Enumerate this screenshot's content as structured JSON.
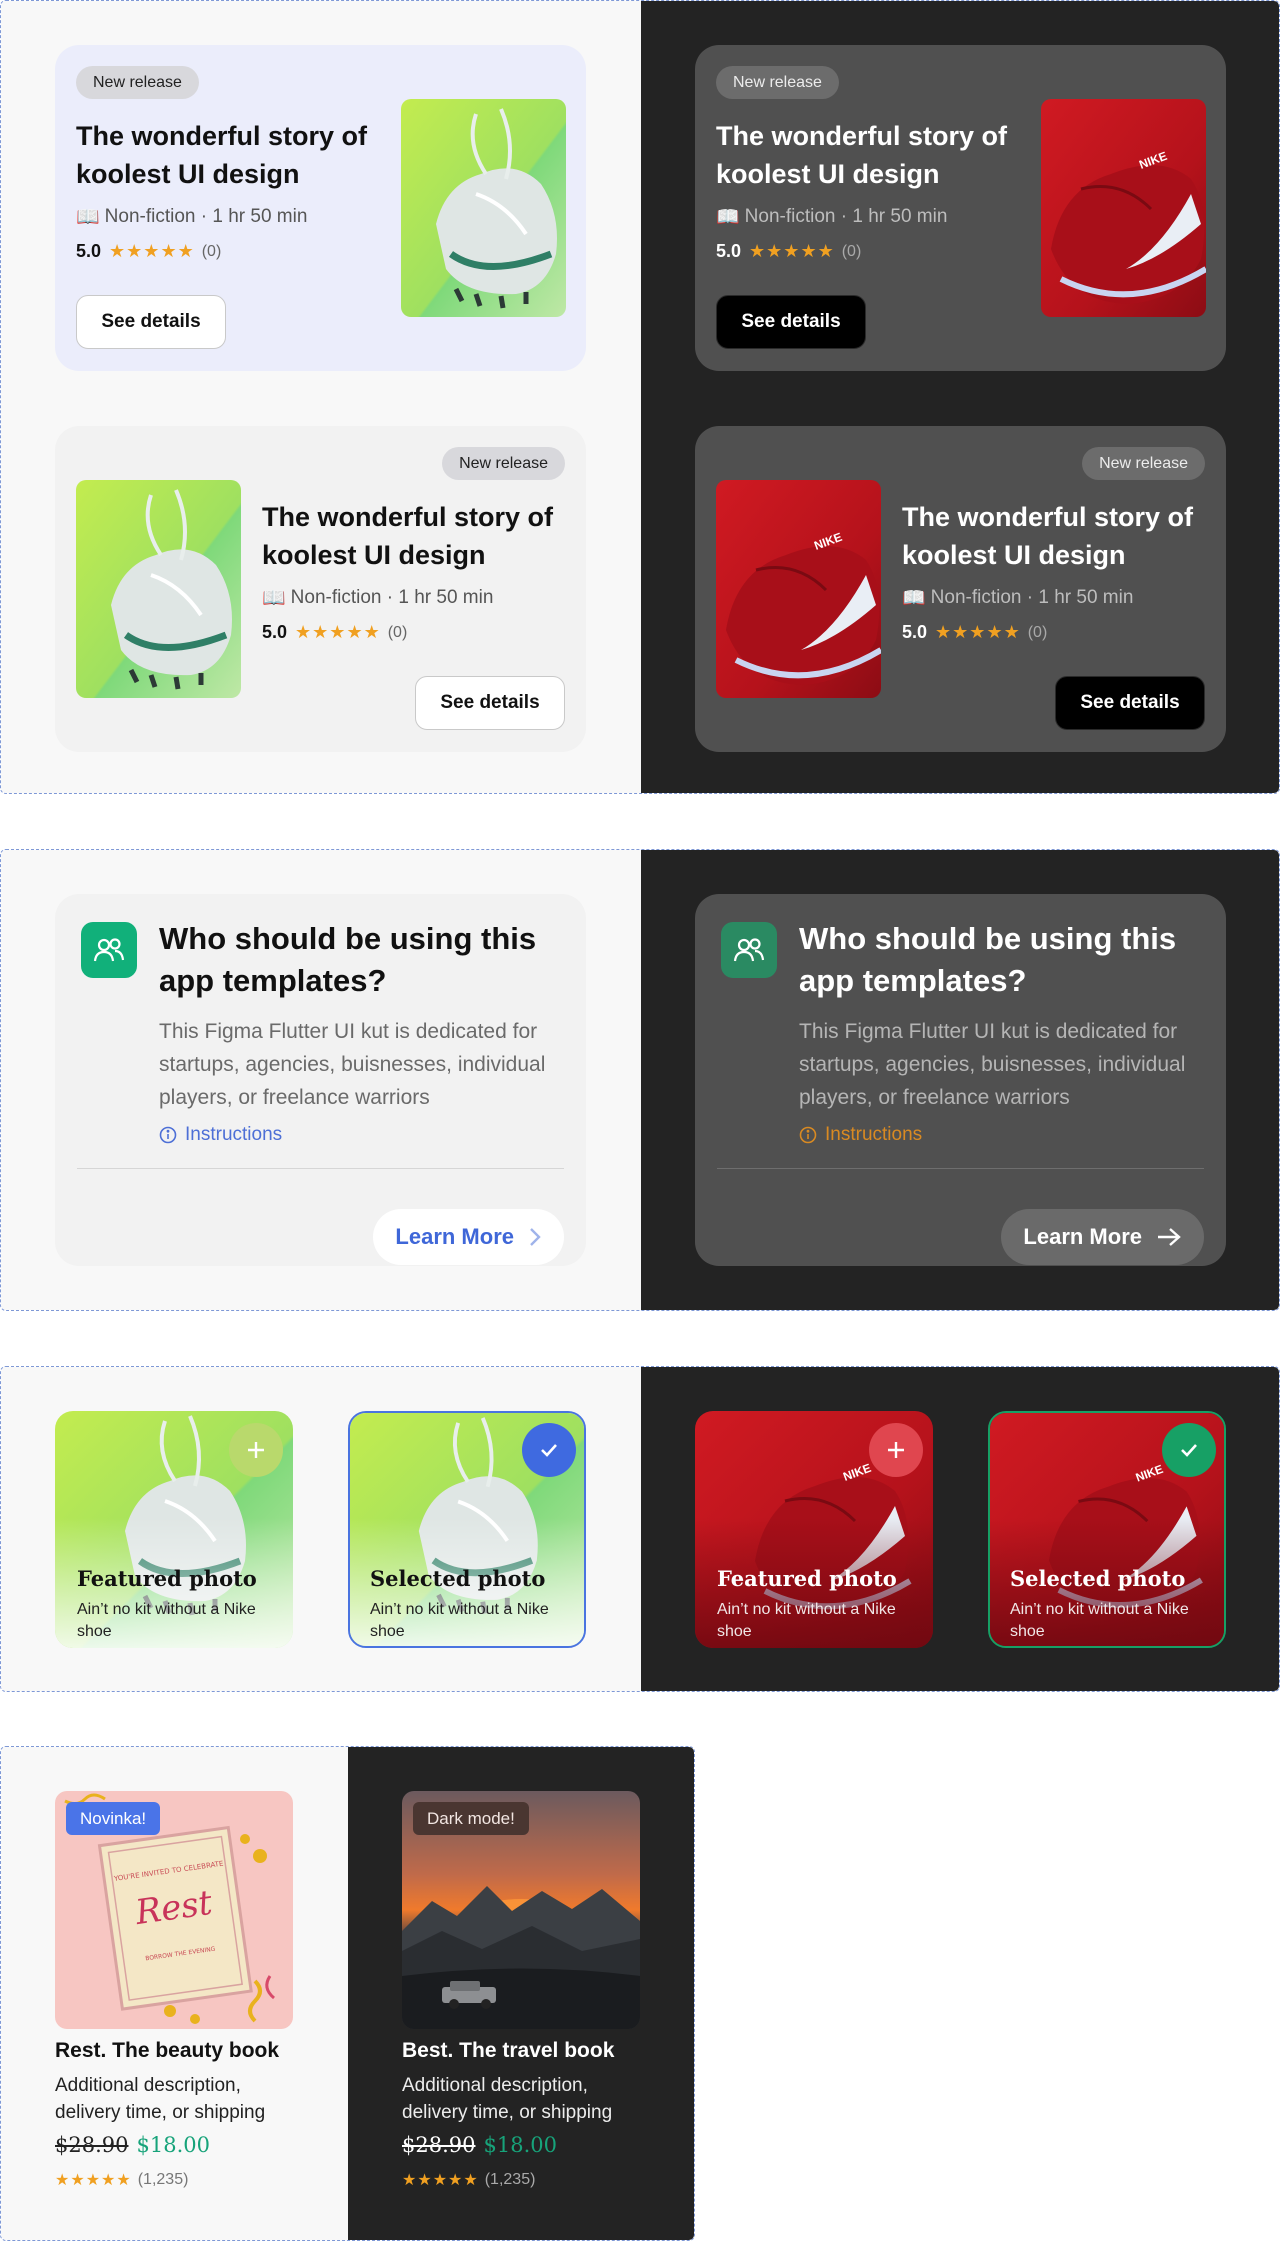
{
  "book_card": {
    "badge": "New release",
    "title": "The wonderful story of koolest UI design",
    "meta": "Non-fiction · 1 hr 50 min",
    "meta_icon": "book-icon",
    "score": "5.0",
    "stars": "★★★★★",
    "count": "(0)",
    "button": "See details"
  },
  "info_card": {
    "icon": "users-icon",
    "title": "Who should be using this app templates?",
    "body": "This Figma Flutter UI kut is dedicated for startups, agencies, buisnesses, individual players, or freelance warriors",
    "link": "Instructions",
    "button": "Learn More",
    "colors": {
      "icon_light": "#11b07a",
      "icon_dark": "#2a8a62",
      "link_light": "#4d6fd6",
      "link_dark": "#d98a22",
      "btn_light_text": "#3f67d8"
    }
  },
  "photo_tiles": {
    "featured": {
      "title": "Featured photo",
      "subtitle": "Ain’t no kit without a Nike shoe",
      "action_icon": "plus-icon"
    },
    "selected": {
      "title": "Selected photo",
      "subtitle": "Ain’t no kit without a Nike shoe",
      "action_icon": "check-icon"
    },
    "colors": {
      "light_check": "#3f6ae0",
      "dark_check": "#17a065"
    }
  },
  "products": [
    {
      "badge": "Novinka!",
      "title": "Rest. The beauty book",
      "desc": "Additional description, delivery time, or shipping",
      "old_price": "$28.90",
      "new_price": "$18.00",
      "stars": "★★★★★",
      "count": "(1,235)",
      "image_text_top": "YOU'RE INVITED TO CELEBRATE",
      "image_text_main": "Rest",
      "image_text_bottom": "BORROW THE EVENING"
    },
    {
      "badge": "Dark mode!",
      "title": "Best. The travel book",
      "desc": "Additional description, delivery time, or shipping",
      "old_price": "$28.90",
      "new_price": "$18.00",
      "stars": "★★★★★",
      "count": "(1,235)"
    }
  ]
}
